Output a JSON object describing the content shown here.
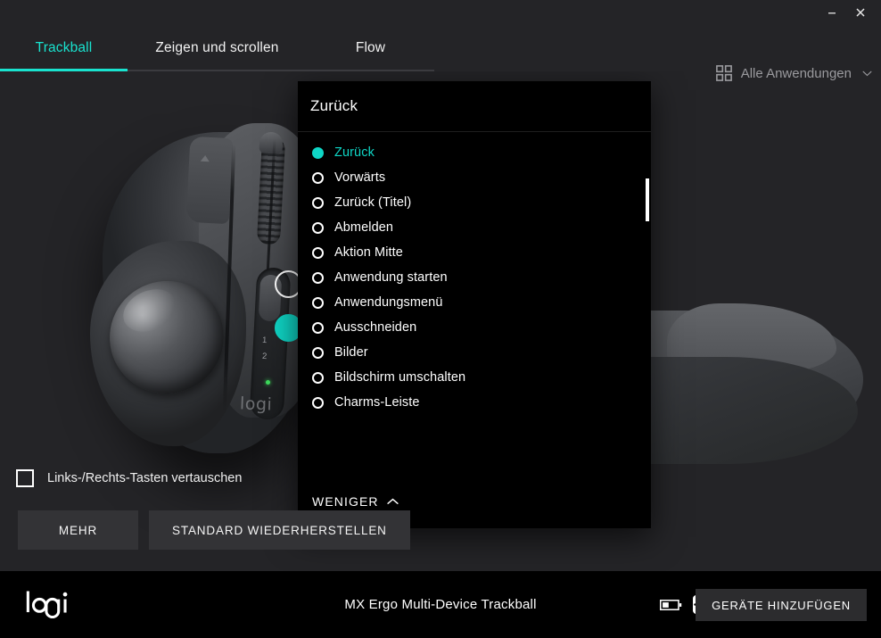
{
  "window": {
    "minimize_label": "–",
    "close_label": "×"
  },
  "tabs": {
    "items": [
      {
        "label": "Trackball",
        "active": true
      },
      {
        "label": "Zeigen und scrollen",
        "active": false
      },
      {
        "label": "Flow",
        "active": false
      }
    ]
  },
  "app_selector": {
    "label": "Alle Anwendungen",
    "grid_icon": "grid-apps-icon",
    "chevron_icon": "chevron-down-icon"
  },
  "device_illustration": {
    "brand_emboss": "logi",
    "switch_numbers": [
      "1",
      "2"
    ],
    "hotspots": [
      {
        "name": "button-top-left",
        "selected": false
      },
      {
        "name": "button-middle-left",
        "selected": true
      },
      {
        "name": "button-wheel",
        "selected": false
      },
      {
        "name": "button-left-click",
        "selected": false
      },
      {
        "name": "button-right-click",
        "selected": false
      }
    ]
  },
  "panel": {
    "title": "Zurück",
    "selected_value": "Zurück",
    "options": [
      "Zurück",
      "Vorwärts",
      "Zurück (Titel)",
      "Abmelden",
      "Aktion Mitte",
      "Anwendung starten",
      "Anwendungsmenü",
      "Ausschneiden",
      "Bilder",
      "Bildschirm umschalten",
      "Charms-Leiste"
    ],
    "footer_label": "WENIGER",
    "footer_icon": "chevron-up-icon"
  },
  "options_area": {
    "swap_buttons_label": "Links-/Rechts-Tasten vertauschen",
    "swap_buttons_checked": false,
    "more_button": "MEHR",
    "restore_default_button": "STANDARD WIEDERHERSTELLEN"
  },
  "footer": {
    "logo": "logi",
    "device_name": "MX Ergo Multi-Device Trackball",
    "battery_icon": "battery-icon",
    "unifying_icon": "unifying-receiver-icon",
    "add_devices_button": "GERÄTE HINZUFÜGEN"
  },
  "colors": {
    "accent": "#0fd6c6",
    "tab_accent": "#19e3cf",
    "app_background": "#242427",
    "panel_background": "#000000",
    "footer_background": "#000000",
    "button_background": "#333336"
  }
}
